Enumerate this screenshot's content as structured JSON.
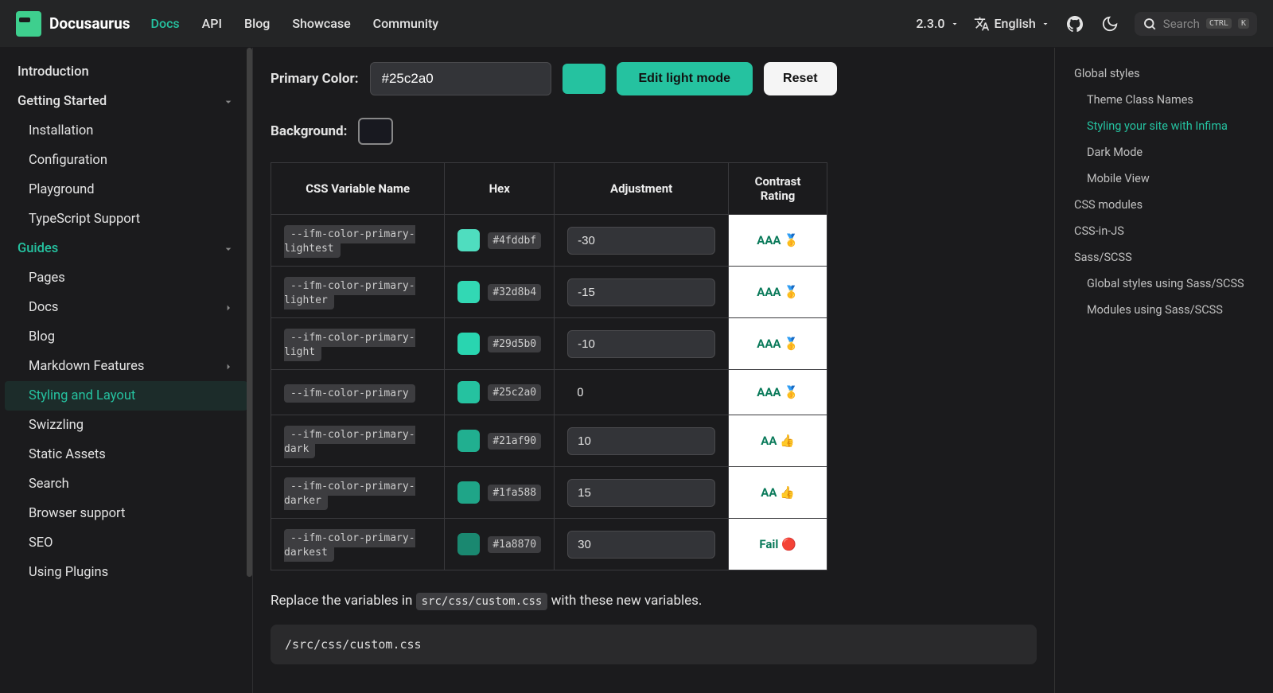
{
  "brand": "Docusaurus",
  "nav": {
    "docs": "Docs",
    "api": "API",
    "blog": "Blog",
    "showcase": "Showcase",
    "community": "Community",
    "version": "2.3.0",
    "language": "English",
    "search_placeholder": "Search",
    "kbd_ctrl": "CTRL",
    "kbd_k": "K"
  },
  "sidebar": {
    "intro": "Introduction",
    "getting_started": "Getting Started",
    "installation": "Installation",
    "configuration": "Configuration",
    "playground": "Playground",
    "typescript": "TypeScript Support",
    "guides": "Guides",
    "pages": "Pages",
    "docs": "Docs",
    "blog": "Blog",
    "markdown": "Markdown Features",
    "styling": "Styling and Layout",
    "swizzling": "Swizzling",
    "static": "Static Assets",
    "search": "Search",
    "browser": "Browser support",
    "seo": "SEO",
    "plugins": "Using Plugins"
  },
  "controls": {
    "primary_label": "Primary Color:",
    "primary_value": "#25c2a0",
    "edit_light": "Edit light mode",
    "reset": "Reset",
    "background_label": "Background:"
  },
  "table": {
    "h1": "CSS Variable Name",
    "h2": "Hex",
    "h3": "Adjustment",
    "h4": "Contrast Rating",
    "rows": [
      {
        "var": "--ifm-color-primary-lightest",
        "hex": "#4fddbf",
        "adj": "-30",
        "rating": "AAA 🥇"
      },
      {
        "var": "--ifm-color-primary-lighter",
        "hex": "#32d8b4",
        "adj": "-15",
        "rating": "AAA 🥇"
      },
      {
        "var": "--ifm-color-primary-light",
        "hex": "#29d5b0",
        "adj": "-10",
        "rating": "AAA 🥇"
      },
      {
        "var": "--ifm-color-primary",
        "hex": "#25c2a0",
        "adj": "0",
        "rating": "AAA 🥇",
        "noinput": true
      },
      {
        "var": "--ifm-color-primary-dark",
        "hex": "#21af90",
        "adj": "10",
        "rating": "AA 👍"
      },
      {
        "var": "--ifm-color-primary-darker",
        "hex": "#1fa588",
        "adj": "15",
        "rating": "AA 👍"
      },
      {
        "var": "--ifm-color-primary-darkest",
        "hex": "#1a8870",
        "adj": "30",
        "rating": "Fail 🔴"
      }
    ]
  },
  "desc": {
    "pre": "Replace the variables in ",
    "code": "src/css/custom.css",
    "post": " with these new variables."
  },
  "codeblock": {
    "title": "/src/css/custom.css"
  },
  "toc": {
    "global": "Global styles",
    "theme_class": "Theme Class Names",
    "infima": "Styling your site with Infima",
    "dark": "Dark Mode",
    "mobile": "Mobile View",
    "css_modules": "CSS modules",
    "css_in_js": "CSS-in-JS",
    "sass": "Sass/SCSS",
    "sass_global": "Global styles using Sass/SCSS",
    "sass_modules": "Modules using Sass/SCSS"
  }
}
